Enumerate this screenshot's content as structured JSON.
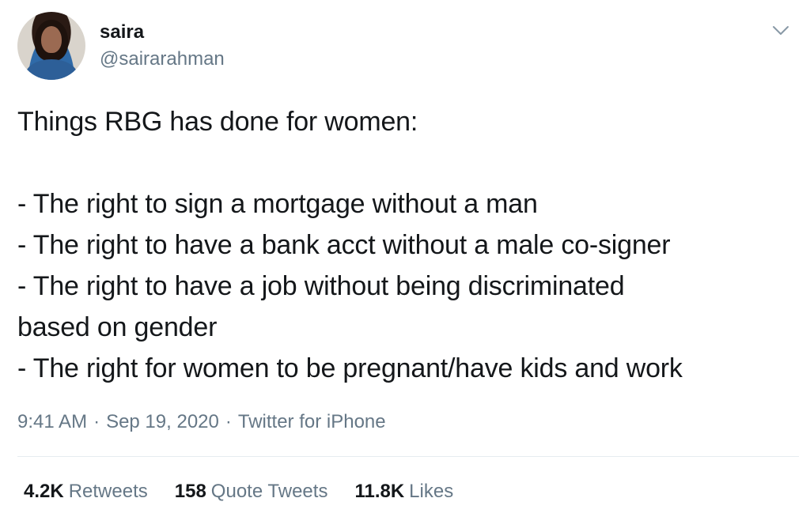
{
  "user": {
    "display_name": "saira",
    "handle": "@sairarahman",
    "avatar_icon": "profile-photo"
  },
  "menu": {
    "icon": "chevron-down-icon"
  },
  "tweet": {
    "text": "Things RBG has done for women:\n\n- The right to sign a mortgage without a man\n- The right to have a bank acct without a male co-signer\n- The right to have a job without being discriminated\nbased on gender\n- The right for women to be pregnant/have kids and work"
  },
  "meta": {
    "time": "9:41 AM",
    "separator": "·",
    "date": "Sep 19, 2020",
    "source": "Twitter for iPhone"
  },
  "stats": {
    "retweets_count": "4.2K",
    "retweets_label": "Retweets",
    "quotes_count": "158",
    "quotes_label": "Quote Tweets",
    "likes_count": "11.8K",
    "likes_label": "Likes"
  },
  "colors": {
    "text": "#14171a",
    "secondary": "#657786",
    "divider": "#e6ecf0"
  }
}
